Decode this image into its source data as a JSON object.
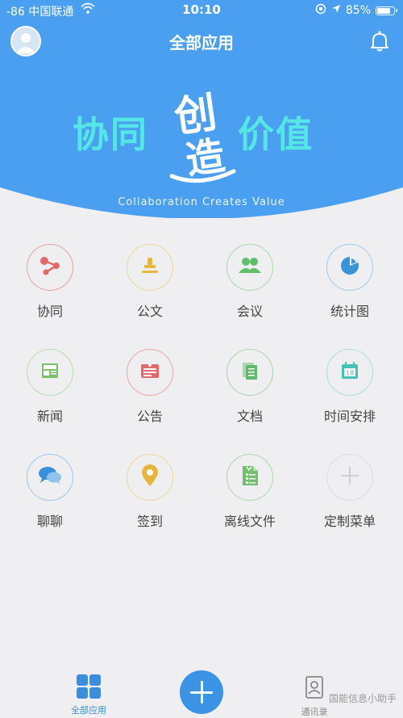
{
  "status_bar": {
    "carrier": "-86 中国联通",
    "time": "10:10",
    "battery": "85%",
    "battery_level": 0.85
  },
  "header": {
    "title": "全部应用",
    "avatar_icon": "user-avatar-icon",
    "bell_icon": "bell-icon"
  },
  "banner": {
    "text_left": "协同",
    "text_callig_1": "创",
    "text_callig_2": "造",
    "text_right": "价值",
    "subtitle": "Collaboration Creates Value"
  },
  "apps": [
    {
      "label": "协同",
      "icon": "share-icon",
      "color": "#e06a6a"
    },
    {
      "label": "公文",
      "icon": "stamp-icon",
      "color": "#e6b73c"
    },
    {
      "label": "会议",
      "icon": "people-icon",
      "color": "#5fbf6a"
    },
    {
      "label": "统计图",
      "icon": "pie-chart-icon",
      "color": "#3b93d8"
    },
    {
      "label": "新闻",
      "icon": "newspaper-icon",
      "color": "#7cc06a"
    },
    {
      "label": "公告",
      "icon": "announcement-icon",
      "color": "#e36b6b"
    },
    {
      "label": "文档",
      "icon": "document-icon",
      "color": "#62b86b"
    },
    {
      "label": "时间安排",
      "icon": "calendar-icon",
      "color": "#45c2b3"
    },
    {
      "label": "聊聊",
      "icon": "chat-bubbles-icon",
      "color": "#3a90d6"
    },
    {
      "label": "签到",
      "icon": "location-pin-icon",
      "color": "#e6b53a"
    },
    {
      "label": "离线文件",
      "icon": "offline-file-icon",
      "color": "#72c06b"
    },
    {
      "label": "定制菜单",
      "icon": "add-icon",
      "color": "#cfcfcf"
    }
  ],
  "tabbar": {
    "tab1": "全部应用",
    "tab3": "通讯录"
  },
  "watermark": "国能信息小助手"
}
